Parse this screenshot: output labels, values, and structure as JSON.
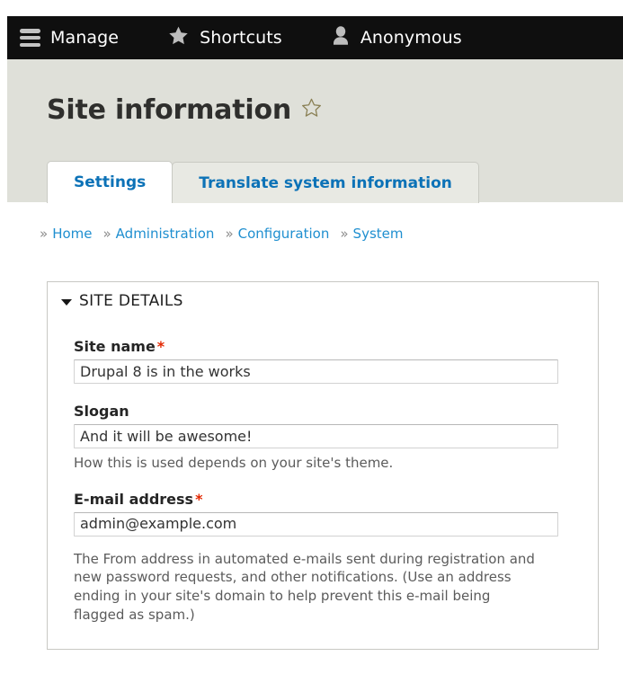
{
  "toolbar": {
    "items": [
      {
        "label": "Manage",
        "icon": "hamburger-menu-icon"
      },
      {
        "label": "Shortcuts",
        "icon": "star-icon"
      },
      {
        "label": "Anonymous",
        "icon": "user-icon"
      }
    ]
  },
  "header": {
    "title": "Site information",
    "favorite_icon": "star-outline-icon"
  },
  "tabs": [
    {
      "label": "Settings",
      "active": true
    },
    {
      "label": "Translate system information",
      "active": false
    }
  ],
  "breadcrumb": {
    "separator": "»",
    "items": [
      {
        "label": "Home"
      },
      {
        "label": "Administration"
      },
      {
        "label": "Configuration"
      },
      {
        "label": "System"
      }
    ]
  },
  "fieldset": {
    "legend": "SITE DETAILS",
    "collapse_icon": "triangle-down-icon",
    "fields": [
      {
        "label": "Site name",
        "required_marker": "*",
        "value": "Drupal 8 is in the works",
        "placeholder": "",
        "description": ""
      },
      {
        "label": "Slogan",
        "required_marker": "",
        "value": "And it will be awesome!",
        "placeholder": "",
        "description": "How this is used depends on your site's theme."
      },
      {
        "label": "E-mail address",
        "required_marker": "*",
        "value": "admin@example.com",
        "placeholder": "",
        "description": "The From address in automated e-mails sent during registration and new password requests, and other notifications. (Use an address ending in your site's domain to help prevent this e-mail being flagged as spam.)"
      }
    ]
  },
  "colors": {
    "toolbar_bg": "#0f0f0f",
    "header_bg": "#dfe0d9",
    "link_blue": "#1f8fd0",
    "tab_blue": "#0c72b7",
    "required_red": "#e32700",
    "star_outline": "#8a8055"
  }
}
